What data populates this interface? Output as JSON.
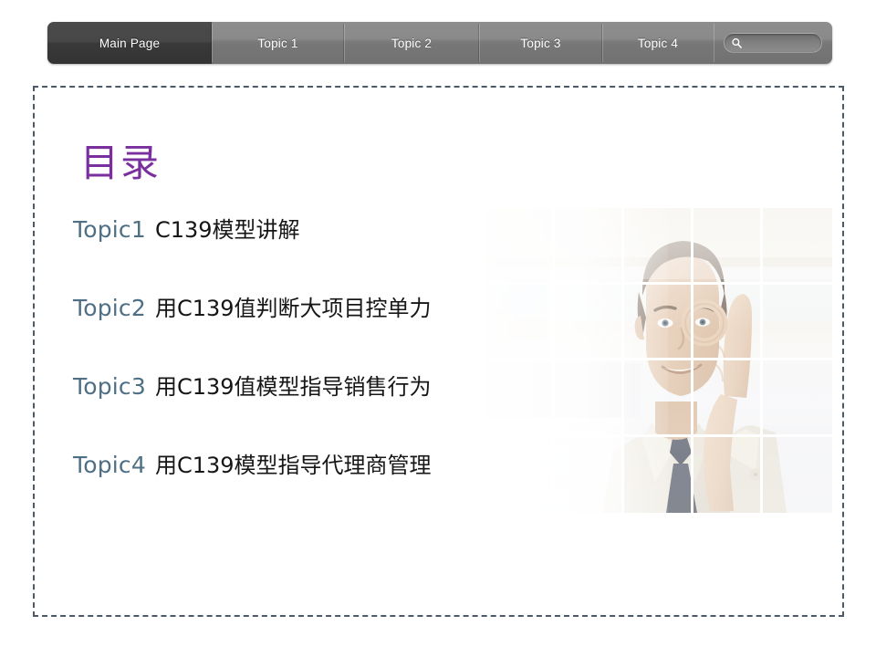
{
  "nav": {
    "tabs": [
      {
        "label": "Main Page",
        "active": true
      },
      {
        "label": "Topic 1",
        "active": false
      },
      {
        "label": "Topic 2",
        "active": false
      },
      {
        "label": "Topic 3",
        "active": false
      },
      {
        "label": "Topic 4",
        "active": false
      }
    ],
    "search": {
      "icon": "search-icon",
      "value": "",
      "placeholder": ""
    }
  },
  "slide": {
    "title": "目录",
    "title_color": "#7a2f9e",
    "key_color": "#4f6f85",
    "toc": [
      {
        "key": "Topic1",
        "value": "C139模型讲解"
      },
      {
        "key": "Topic2",
        "value": "用C139值判断大项目控单力"
      },
      {
        "key": "Topic3",
        "value": "用C139值模型指导销售行为"
      },
      {
        "key": "Topic4",
        "value": "用C139模型指导代理商管理"
      }
    ],
    "photo": {
      "alt": "businessman making ok hand gesture over eye",
      "grid_columns": 5,
      "grid_rows": 4,
      "grid_line_color": "#ffffff"
    }
  }
}
